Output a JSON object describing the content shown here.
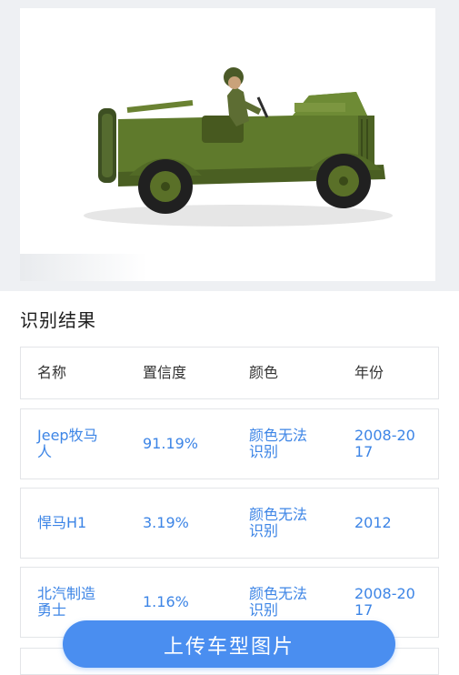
{
  "section_title": "识别结果",
  "table": {
    "headers": [
      "名称",
      "置信度",
      "颜色",
      "年份"
    ],
    "rows": [
      {
        "name": "Jeep牧马人",
        "confidence": "91.19%",
        "color": "颜色无法识别",
        "year": "2008-2017"
      },
      {
        "name": "悍马H1",
        "confidence": "3.19%",
        "color": "颜色无法识别",
        "year": "2012"
      },
      {
        "name": "北汽制造勇士",
        "confidence": "1.16%",
        "color": "颜色无法识别",
        "year": "2008-2017"
      }
    ]
  },
  "upload_button": "上传车型图片",
  "colors": {
    "accent": "#4a8ef0",
    "link_text": "#3d85e6",
    "border": "#e3e5e8",
    "photo_frame": "#eef0f3"
  }
}
